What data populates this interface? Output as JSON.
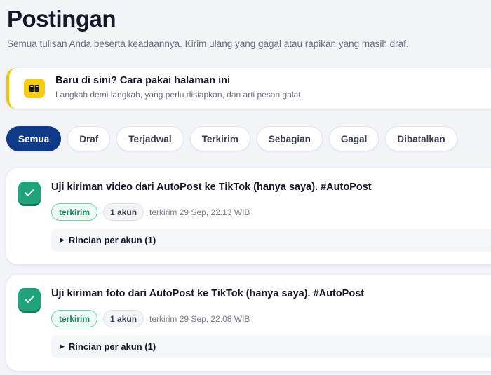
{
  "page": {
    "title": "Postingan",
    "subtitle": "Semua tulisan Anda beserta keadaannya. Kirim ulang yang gagal atau rapikan yang masih draf."
  },
  "guide": {
    "title": "Baru di sini? Cara pakai halaman ini",
    "subtitle": "Langkah demi langkah, yang perlu disiapkan, dan arti pesan galat",
    "icon": "book-icon"
  },
  "filters": [
    {
      "label": "Semua",
      "active": true
    },
    {
      "label": "Draf"
    },
    {
      "label": "Terjadwal"
    },
    {
      "label": "Terkirim"
    },
    {
      "label": "Sebagian"
    },
    {
      "label": "Gagal"
    },
    {
      "label": "Dibatalkan"
    }
  ],
  "posts": [
    {
      "text": "Uji kiriman video dari AutoPost ke TikTok (hanya saya). #AutoPost",
      "status": "terkirim",
      "accounts": "1 akun",
      "time": "terkirim 29 Sep, 22.13 WIB",
      "details": "Rincian per akun (1)"
    },
    {
      "text": "Uji kiriman foto dari AutoPost ke TikTok (hanya saya). #AutoPost",
      "status": "terkirim",
      "accounts": "1 akun",
      "time": "terkirim 29 Sep, 22.08 WIB",
      "details": "Rincian per akun (1)"
    }
  ],
  "colors": {
    "accent": "#0f3a88",
    "guide_border": "#f2c500",
    "success": "#20a27a"
  }
}
